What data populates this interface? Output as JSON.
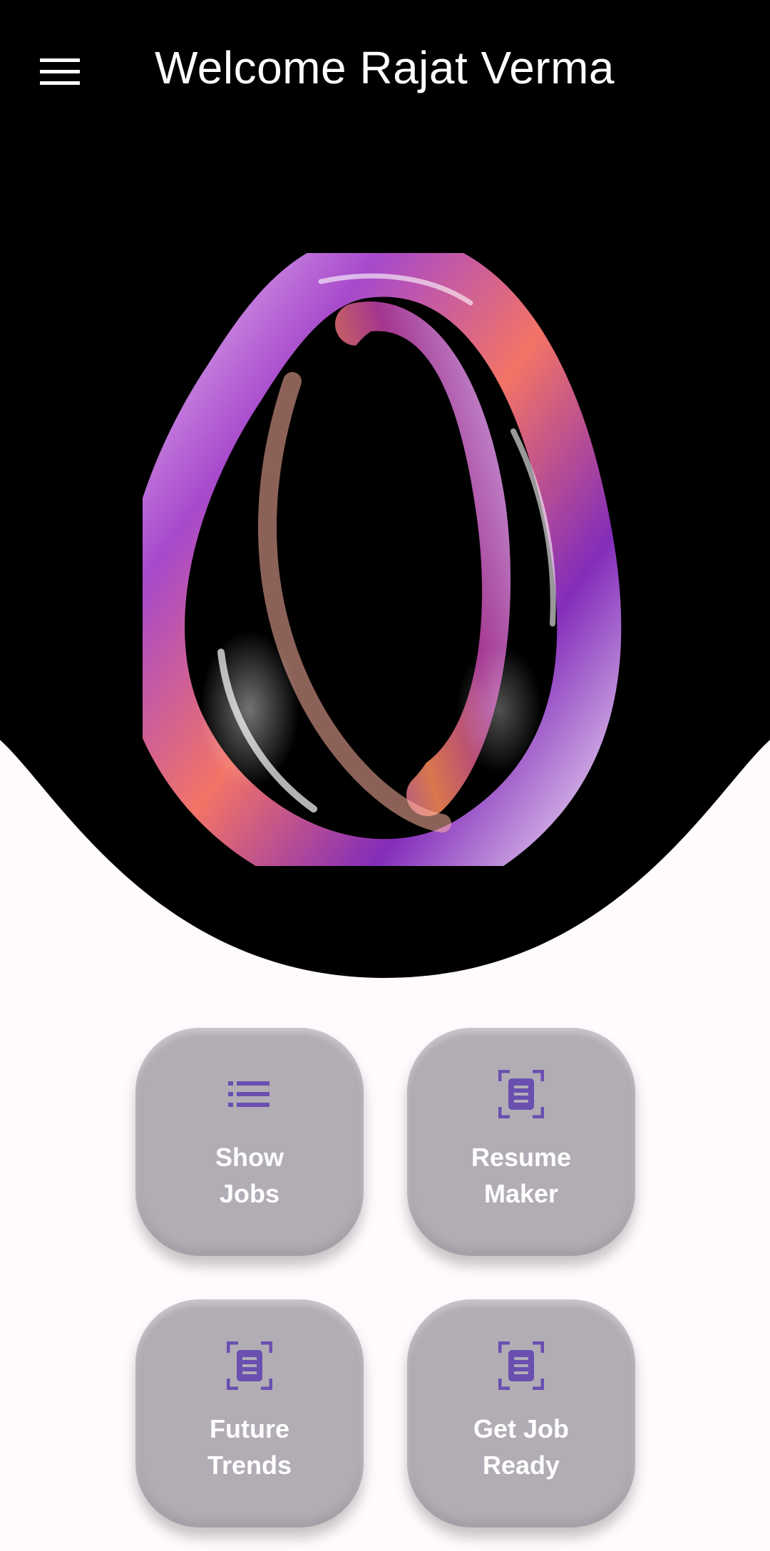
{
  "header": {
    "title": "Welcome Rajat Verma",
    "menu_icon": "hamburger-menu-icon"
  },
  "hero": {
    "background_color": "#000000",
    "artwork": "abstract-glass-ring-artwork",
    "accent_colors": [
      "#c77dff",
      "#ff6f61",
      "#7b2cbf"
    ]
  },
  "actions": [
    {
      "label": "Show\nJobs",
      "icon": "list-icon"
    },
    {
      "label": "Resume\nMaker",
      "icon": "document-scan-icon"
    },
    {
      "label": "Future\nTrends",
      "icon": "document-scan-icon"
    },
    {
      "label": "Get Job\nReady",
      "icon": "document-scan-icon"
    }
  ],
  "colors": {
    "card_background": "#b2adb5",
    "icon_color": "#6a4fb0",
    "card_text": "#ffffff",
    "page_background": "#fffafd"
  }
}
